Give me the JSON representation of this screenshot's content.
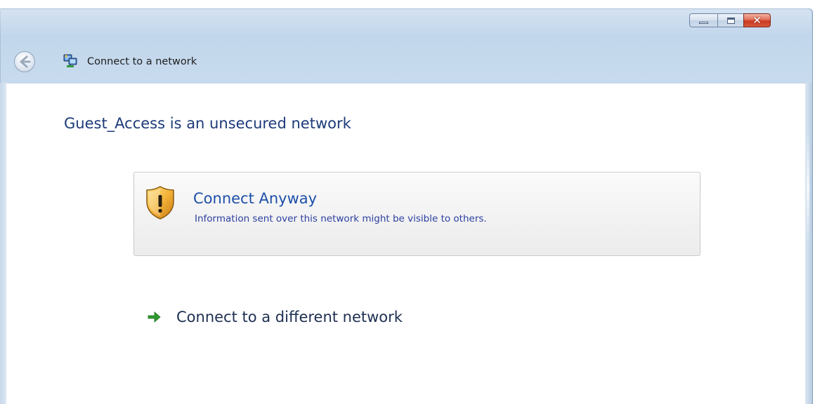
{
  "window": {
    "title": "Connect to a network",
    "caption_buttons": {
      "minimize_icon": "minimize-icon",
      "maximize_icon": "maximize-icon",
      "close_icon": "close-icon",
      "close_glyph": "✕"
    }
  },
  "navigation": {
    "back_icon": "back-arrow-icon",
    "title_icon": "network-icon"
  },
  "content": {
    "heading": "Guest_Access is an unsecured network",
    "options": [
      {
        "icon": "security-warning-shield-icon",
        "title": "Connect Anyway",
        "description": "Information sent over this network might be visible to others."
      }
    ],
    "link": {
      "icon": "green-arrow-icon",
      "label": "Connect to a different network"
    }
  },
  "colors": {
    "heading": "#1c3a78",
    "option_title": "#1d4fa8",
    "option_description": "#2b3fa0",
    "close_button": "#cb3a21",
    "arrow": "#2f9a2f"
  }
}
